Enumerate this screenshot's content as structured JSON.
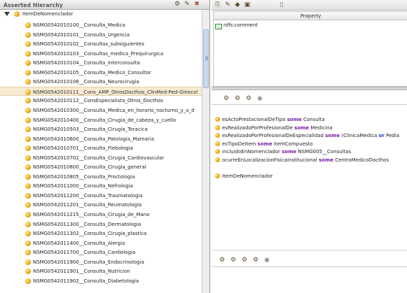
{
  "left_panel": {
    "title": "Asserted Hierarchy",
    "toolbar_icons": [
      "add-subclass-icon",
      "add-sibling-icon",
      "delete-class-icon"
    ],
    "root": {
      "label": "ItemDeNomenclador",
      "expanded": true
    },
    "items": [
      "NSMG0542010100__Consulta_Medica",
      "NSMG0542010101__Consulta_Urgencia",
      "NSMG0542010102__Consultas_subsiguientes",
      "NSMG0542010103__Consultas_medica_Prequirurgica",
      "NSMG0542010104__Consulta_Interconsulta",
      "NSMG0542010105__Consulta_Medico_Consultor",
      "NSMG0542010106__Consulta_Neurocirugia",
      "NSMG0542010111__Cons_AMP_OtrosDocthos_ClinMed-Ped-Ginecol",
      "NSMG0542010112__ConsEspecialista_Otros_Docthos",
      "NSMG0542010300__Consulta_Medica_en_horario_nocturno_y_o_d",
      "NSMG0542010400__Consulta_Cirugia_de_cabeza_y_cuello",
      "NSMG0542010503__Consulta_Cirugia_Toracica",
      "NSMG0542010600__Consulta_Patologia_Mamaria",
      "NSMG0542010701__Consulta_Flebologia",
      "NSMG0542010702__Consulta_Cirugia_Cardiovascular",
      "NSMG0542010800__Consulta_Cirugia_general",
      "NSMG0542010805__Consulta_Proctologia",
      "NSMG0542011000__Consulta_Nefrologia",
      "NSMG0542011200__Consulta_Traumatologia",
      "NSMG0542011201__Consulta_Reumatologia",
      "NSMG0542011215__Consulta_Cirugia_de_Mano",
      "NSMG0542011300__Consulta_Dermatologia",
      "NSMG0542011302__Consulta_Cirugia_plastica",
      "NSMG0542011400__Consulta_Alergia",
      "NSMG0542011700__Consulta_Cardiologia",
      "NSMG0542011900__Consulta_Endocrinologia",
      "NSMG0542011901__Consulta_Nutricion",
      "NSMG0542011902__Consulta_Diabetologia"
    ],
    "selected_index": 7
  },
  "annotations_panel": {
    "toolbar_icons": [
      "add-annotation-icon",
      "add-value-icon",
      "edit-annotation-icon",
      "delete-annotation-icon"
    ],
    "column_header": "Property",
    "rows": [
      "rdfs:comment"
    ]
  },
  "conditions_panel": {
    "toolbar_icons": [
      "add-named-class-icon",
      "add-restriction-icon",
      "add-expression-icon",
      "remove-condition-icon"
    ],
    "expressions": [
      {
        "pre": "esActoPrestacionalDeTipo ",
        "kw": "some",
        "post": " Consulta",
        "kw2": "",
        "post2": ""
      },
      {
        "pre": "esRealizadoPorProfesionalDe ",
        "kw": "some",
        "post": " Medicina",
        "kw2": "",
        "post2": ""
      },
      {
        "pre": "esRealizadoPorProfesionalDeEspecialidad ",
        "kw": "some",
        "post": " (ClinicaMedica ",
        "kw2": "or",
        "post2": " Pedia"
      },
      {
        "pre": "esTipoDeItem ",
        "kw": "some",
        "post": " ItemCompuesto",
        "kw2": "",
        "post2": ""
      },
      {
        "pre": "incluidoEnNomenclador ",
        "kw": "some",
        "post": " NSMG005__Consultas",
        "kw2": "",
        "post2": ""
      },
      {
        "pre": "ocurreEnLocalizacionFisicaInstitucional ",
        "kw": "some",
        "post": " CentroMedicoDocthos",
        "kw2": "",
        "post2": ""
      }
    ],
    "inherited": "ItemDeNomenclador"
  },
  "disjoint_panel": {
    "toolbar_icons": [
      "add-disjoint-icon",
      "add-disjoint-expression-icon",
      "add-all-siblings-icon",
      "remove-disjoint-icon",
      "delete-disjoint-icon"
    ]
  }
}
